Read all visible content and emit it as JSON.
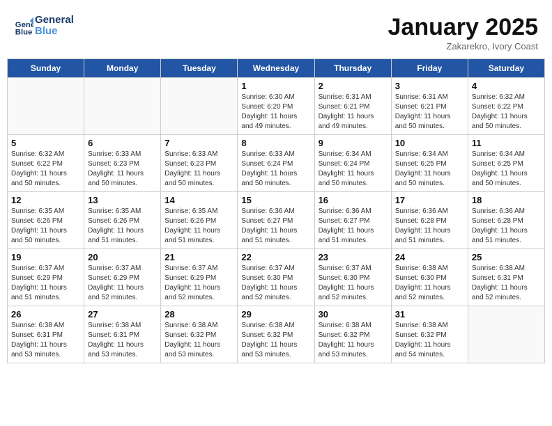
{
  "header": {
    "logo_line1": "General",
    "logo_line2": "Blue",
    "title": "January 2025",
    "subtitle": "Zakarekro, Ivory Coast"
  },
  "weekdays": [
    "Sunday",
    "Monday",
    "Tuesday",
    "Wednesday",
    "Thursday",
    "Friday",
    "Saturday"
  ],
  "weeks": [
    {
      "shade": false,
      "days": [
        {
          "num": "",
          "info": ""
        },
        {
          "num": "",
          "info": ""
        },
        {
          "num": "",
          "info": ""
        },
        {
          "num": "1",
          "info": "Sunrise: 6:30 AM\nSunset: 6:20 PM\nDaylight: 11 hours\nand 49 minutes."
        },
        {
          "num": "2",
          "info": "Sunrise: 6:31 AM\nSunset: 6:21 PM\nDaylight: 11 hours\nand 49 minutes."
        },
        {
          "num": "3",
          "info": "Sunrise: 6:31 AM\nSunset: 6:21 PM\nDaylight: 11 hours\nand 50 minutes."
        },
        {
          "num": "4",
          "info": "Sunrise: 6:32 AM\nSunset: 6:22 PM\nDaylight: 11 hours\nand 50 minutes."
        }
      ]
    },
    {
      "shade": true,
      "days": [
        {
          "num": "5",
          "info": "Sunrise: 6:32 AM\nSunset: 6:22 PM\nDaylight: 11 hours\nand 50 minutes."
        },
        {
          "num": "6",
          "info": "Sunrise: 6:33 AM\nSunset: 6:23 PM\nDaylight: 11 hours\nand 50 minutes."
        },
        {
          "num": "7",
          "info": "Sunrise: 6:33 AM\nSunset: 6:23 PM\nDaylight: 11 hours\nand 50 minutes."
        },
        {
          "num": "8",
          "info": "Sunrise: 6:33 AM\nSunset: 6:24 PM\nDaylight: 11 hours\nand 50 minutes."
        },
        {
          "num": "9",
          "info": "Sunrise: 6:34 AM\nSunset: 6:24 PM\nDaylight: 11 hours\nand 50 minutes."
        },
        {
          "num": "10",
          "info": "Sunrise: 6:34 AM\nSunset: 6:25 PM\nDaylight: 11 hours\nand 50 minutes."
        },
        {
          "num": "11",
          "info": "Sunrise: 6:34 AM\nSunset: 6:25 PM\nDaylight: 11 hours\nand 50 minutes."
        }
      ]
    },
    {
      "shade": false,
      "days": [
        {
          "num": "12",
          "info": "Sunrise: 6:35 AM\nSunset: 6:26 PM\nDaylight: 11 hours\nand 50 minutes."
        },
        {
          "num": "13",
          "info": "Sunrise: 6:35 AM\nSunset: 6:26 PM\nDaylight: 11 hours\nand 51 minutes."
        },
        {
          "num": "14",
          "info": "Sunrise: 6:35 AM\nSunset: 6:26 PM\nDaylight: 11 hours\nand 51 minutes."
        },
        {
          "num": "15",
          "info": "Sunrise: 6:36 AM\nSunset: 6:27 PM\nDaylight: 11 hours\nand 51 minutes."
        },
        {
          "num": "16",
          "info": "Sunrise: 6:36 AM\nSunset: 6:27 PM\nDaylight: 11 hours\nand 51 minutes."
        },
        {
          "num": "17",
          "info": "Sunrise: 6:36 AM\nSunset: 6:28 PM\nDaylight: 11 hours\nand 51 minutes."
        },
        {
          "num": "18",
          "info": "Sunrise: 6:36 AM\nSunset: 6:28 PM\nDaylight: 11 hours\nand 51 minutes."
        }
      ]
    },
    {
      "shade": true,
      "days": [
        {
          "num": "19",
          "info": "Sunrise: 6:37 AM\nSunset: 6:29 PM\nDaylight: 11 hours\nand 51 minutes."
        },
        {
          "num": "20",
          "info": "Sunrise: 6:37 AM\nSunset: 6:29 PM\nDaylight: 11 hours\nand 52 minutes."
        },
        {
          "num": "21",
          "info": "Sunrise: 6:37 AM\nSunset: 6:29 PM\nDaylight: 11 hours\nand 52 minutes."
        },
        {
          "num": "22",
          "info": "Sunrise: 6:37 AM\nSunset: 6:30 PM\nDaylight: 11 hours\nand 52 minutes."
        },
        {
          "num": "23",
          "info": "Sunrise: 6:37 AM\nSunset: 6:30 PM\nDaylight: 11 hours\nand 52 minutes."
        },
        {
          "num": "24",
          "info": "Sunrise: 6:38 AM\nSunset: 6:30 PM\nDaylight: 11 hours\nand 52 minutes."
        },
        {
          "num": "25",
          "info": "Sunrise: 6:38 AM\nSunset: 6:31 PM\nDaylight: 11 hours\nand 52 minutes."
        }
      ]
    },
    {
      "shade": false,
      "days": [
        {
          "num": "26",
          "info": "Sunrise: 6:38 AM\nSunset: 6:31 PM\nDaylight: 11 hours\nand 53 minutes."
        },
        {
          "num": "27",
          "info": "Sunrise: 6:38 AM\nSunset: 6:31 PM\nDaylight: 11 hours\nand 53 minutes."
        },
        {
          "num": "28",
          "info": "Sunrise: 6:38 AM\nSunset: 6:32 PM\nDaylight: 11 hours\nand 53 minutes."
        },
        {
          "num": "29",
          "info": "Sunrise: 6:38 AM\nSunset: 6:32 PM\nDaylight: 11 hours\nand 53 minutes."
        },
        {
          "num": "30",
          "info": "Sunrise: 6:38 AM\nSunset: 6:32 PM\nDaylight: 11 hours\nand 53 minutes."
        },
        {
          "num": "31",
          "info": "Sunrise: 6:38 AM\nSunset: 6:32 PM\nDaylight: 11 hours\nand 54 minutes."
        },
        {
          "num": "",
          "info": ""
        }
      ]
    }
  ]
}
